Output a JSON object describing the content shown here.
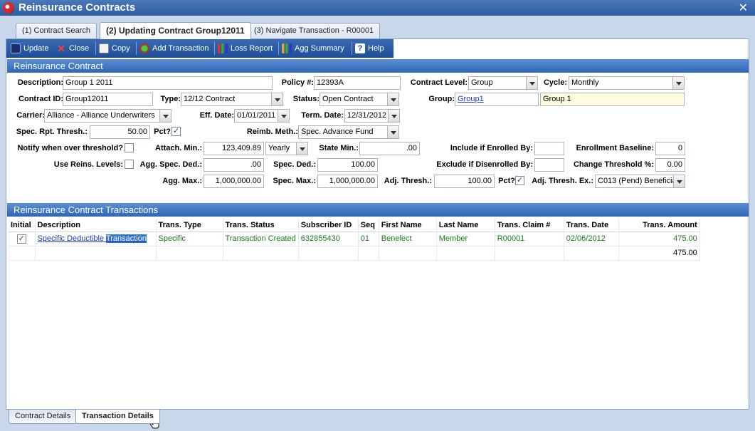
{
  "window": {
    "title": "Reinsurance Contracts",
    "close_glyph": "✕"
  },
  "tabs": [
    {
      "label": "(1) Contract Search"
    },
    {
      "label": "(2) Updating Contract Group12011"
    },
    {
      "label": "(3) Navigate Transaction - R00001"
    }
  ],
  "toolbar": {
    "update": "Update",
    "close": "Close",
    "copy": "Copy",
    "add_transaction": "Add Transaction",
    "loss_report": "Loss Report",
    "agg_summary": "Agg Summary",
    "help": "Help"
  },
  "contract": {
    "header": "Reinsurance Contract",
    "description": {
      "label": "Description:",
      "value": "Group 1 2011"
    },
    "policy": {
      "label": "Policy #:",
      "value": "12393A"
    },
    "contract_level": {
      "label": "Contract Level:",
      "value": "Group"
    },
    "cycle": {
      "label": "Cycle:",
      "value": "Monthly"
    },
    "contract_id": {
      "label": "Contract ID:",
      "value": "Group12011"
    },
    "type": {
      "label": "Type:",
      "value": "12/12 Contract"
    },
    "status": {
      "label": "Status:",
      "value": "Open Contract"
    },
    "group": {
      "label": "Group:",
      "value": "Group1",
      "name": "Group 1"
    },
    "carrier": {
      "label": "Carrier:",
      "value": "Alliance - Alliance Underwriters"
    },
    "eff_date": {
      "label": "Eff. Date:",
      "value": "01/01/2011"
    },
    "term_date": {
      "label": "Term. Date:",
      "value": "12/31/2012"
    },
    "spec_rpt_thresh": {
      "label": "Spec. Rpt. Thresh.:",
      "value": "50.00"
    },
    "pct1": {
      "label": "Pct?",
      "checked": true
    },
    "reimb_meth": {
      "label": "Reimb. Meth.:",
      "value": "Spec. Advance Fund"
    },
    "notify": {
      "label": "Notify when over threshold?",
      "checked": false
    },
    "attach_min": {
      "label": "Attach. Min.:",
      "value": "123,409.89",
      "period": "Yearly"
    },
    "state_min": {
      "label": "State Min.:",
      "value": ".00"
    },
    "include_enrolled": {
      "label": "Include if Enrolled By:",
      "value": ""
    },
    "enrollment_baseline": {
      "label": "Enrollment Baseline:",
      "value": "0"
    },
    "use_reins_levels": {
      "label": "Use Reins. Levels:",
      "checked": false
    },
    "agg_spec_ded": {
      "label": "Agg. Spec. Ded.:",
      "value": ".00"
    },
    "spec_ded": {
      "label": "Spec. Ded.:",
      "value": "100.00"
    },
    "exclude_disenrolled": {
      "label": "Exclude if Disenrolled By:",
      "value": ""
    },
    "change_threshold": {
      "label": "Change Threshold %:",
      "value": "0.00"
    },
    "agg_max": {
      "label": "Agg. Max.:",
      "value": "1,000,000.00"
    },
    "spec_max": {
      "label": "Spec. Max.:",
      "value": "1,000,000.00"
    },
    "adj_thresh": {
      "label": "Adj. Thresh.:",
      "value": "100.00"
    },
    "pct2": {
      "label": "Pct?",
      "checked": true
    },
    "adj_thresh_ex": {
      "label": "Adj. Thresh. Ex.:",
      "value": "C013 (Pend) Beneficia"
    }
  },
  "transactions": {
    "header": "Reinsurance Contract Transactions",
    "columns": [
      "Initial",
      "Description",
      "Trans. Type",
      "Trans. Status",
      "Subscriber ID",
      "Seq",
      "First Name",
      "Last Name",
      "Trans. Claim #",
      "Trans. Date",
      "Trans. Amount"
    ],
    "row": {
      "initial_checked": true,
      "description_a": "Specific Deductible ",
      "description_b": "Transaction",
      "type": "Specific",
      "status": "Transaction Created",
      "subscriber_id": "632855430",
      "seq": "01",
      "first_name": "Benelect",
      "last_name": "Member",
      "claim": "R00001",
      "date": "02/06/2012",
      "amount": "475.00"
    },
    "total": "475.00"
  },
  "bottom_tabs": [
    {
      "label": "Contract Details"
    },
    {
      "label": "Transaction Details"
    }
  ]
}
